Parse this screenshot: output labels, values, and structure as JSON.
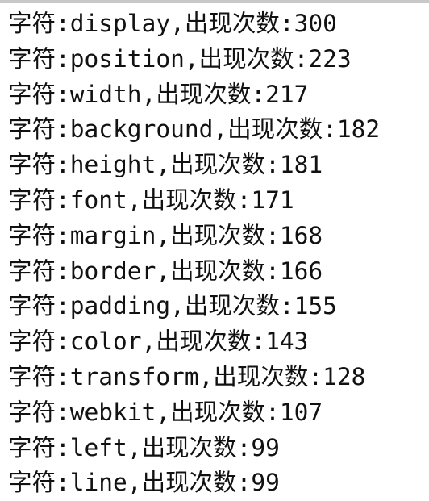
{
  "prefix": "字符:",
  "separator": ",出现次数:",
  "lines": [
    {
      "word": "display",
      "count": "300"
    },
    {
      "word": "position",
      "count": "223"
    },
    {
      "word": "width",
      "count": "217"
    },
    {
      "word": "background",
      "count": "182"
    },
    {
      "word": "height",
      "count": "181"
    },
    {
      "word": "font",
      "count": "171"
    },
    {
      "word": "margin",
      "count": "168"
    },
    {
      "word": "border",
      "count": "166"
    },
    {
      "word": "padding",
      "count": "155"
    },
    {
      "word": "color",
      "count": "143"
    },
    {
      "word": "transform",
      "count": "128"
    },
    {
      "word": "webkit",
      "count": "107"
    },
    {
      "word": "left",
      "count": "99"
    },
    {
      "word": "line",
      "count": "99"
    }
  ]
}
